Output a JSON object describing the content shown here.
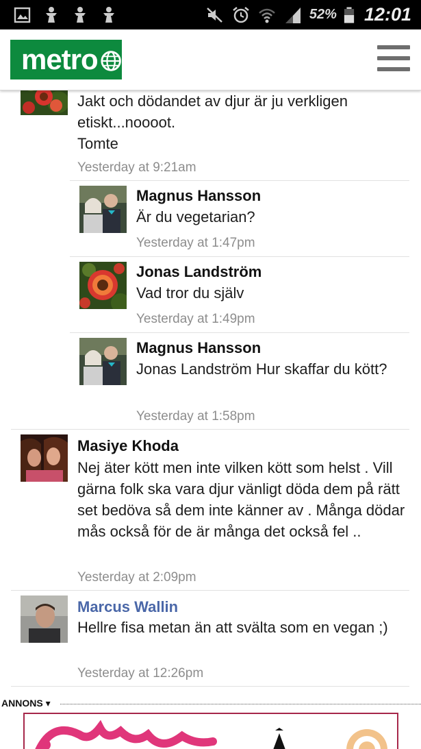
{
  "status_bar": {
    "battery_percent": "52%",
    "time": "12:01",
    "left_icons": [
      "gallery-icon",
      "figure-icon",
      "figure-icon",
      "figure-icon"
    ],
    "right_icons": [
      "mute-icon",
      "alarm-icon",
      "wifi-icon",
      "signal-icon",
      "battery-icon"
    ]
  },
  "header": {
    "logo_text": "metro",
    "brand_color": "#0d8a3e",
    "menu_icon": "hamburger-menu-icon"
  },
  "comments": [
    {
      "author": "",
      "text": "Jakt och dödandet av djur är ju verkligen etiskt...noooot.\nTomte",
      "time": "Yesterday at 9:21am",
      "avatar": "flower-avatar"
    },
    {
      "author": "Magnus Hansson",
      "text": "Är du vegetarian?",
      "time": "Yesterday at 1:47pm",
      "avatar": "couple-avatar"
    },
    {
      "author": "Jonas Landström",
      "text": "Vad tror du själv",
      "time": "Yesterday at 1:49pm",
      "avatar": "flower-avatar"
    },
    {
      "author": "Magnus Hansson",
      "text": "Jonas Landström Hur skaffar du kött?",
      "time": "Yesterday at 1:58pm",
      "avatar": "couple-avatar"
    },
    {
      "author": "Masiye Khoda",
      "text": "Nej äter kött men inte vilken kött som helst . Vill gärna folk ska vara djur vänligt döda dem på rätt set bedöva så dem inte känner av . Många dödar mås också för de är många det också fel ..",
      "time": "Yesterday at 2:09pm",
      "avatar": "two-women-avatar"
    },
    {
      "author": "Marcus Wallin",
      "text": "Hellre fisa metan än att svälta som en vegan ;)",
      "time": "Yesterday at 12:26pm",
      "avatar": "man-avatar",
      "author_color": "#4a67a8"
    }
  ],
  "ad": {
    "label": "ANNONS",
    "arrow": "▾",
    "border_color": "#a6274a"
  }
}
